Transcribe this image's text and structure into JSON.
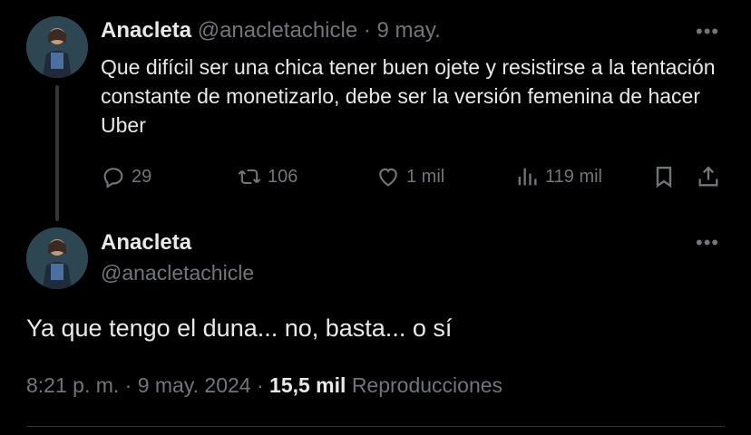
{
  "tweet1": {
    "display_name": "Anacleta",
    "handle": "@anacletachicle",
    "separator": "·",
    "date": "9 may.",
    "text": "Que difícil ser una chica tener buen ojete y resistirse a la tentación constante de monetizarlo, debe ser la versión femenina de hacer Uber",
    "more_icon": "more-horizontal-icon",
    "actions": {
      "replies": "29",
      "retweets": "106",
      "likes": "1 mil",
      "views": "119 mil"
    }
  },
  "tweet2": {
    "display_name": "Anacleta",
    "handle": "@anacletachicle",
    "text": "Ya que tengo el duna... no, basta... o sí",
    "more_icon": "more-horizontal-icon",
    "timestamp": "8:21 p. m. · 9 may. 2024 ·",
    "views_count": "15,5 mil",
    "views_label": "Reproducciones"
  },
  "colors": {
    "background": "#000000",
    "text": "#e7e9ea",
    "muted": "#71767b"
  }
}
